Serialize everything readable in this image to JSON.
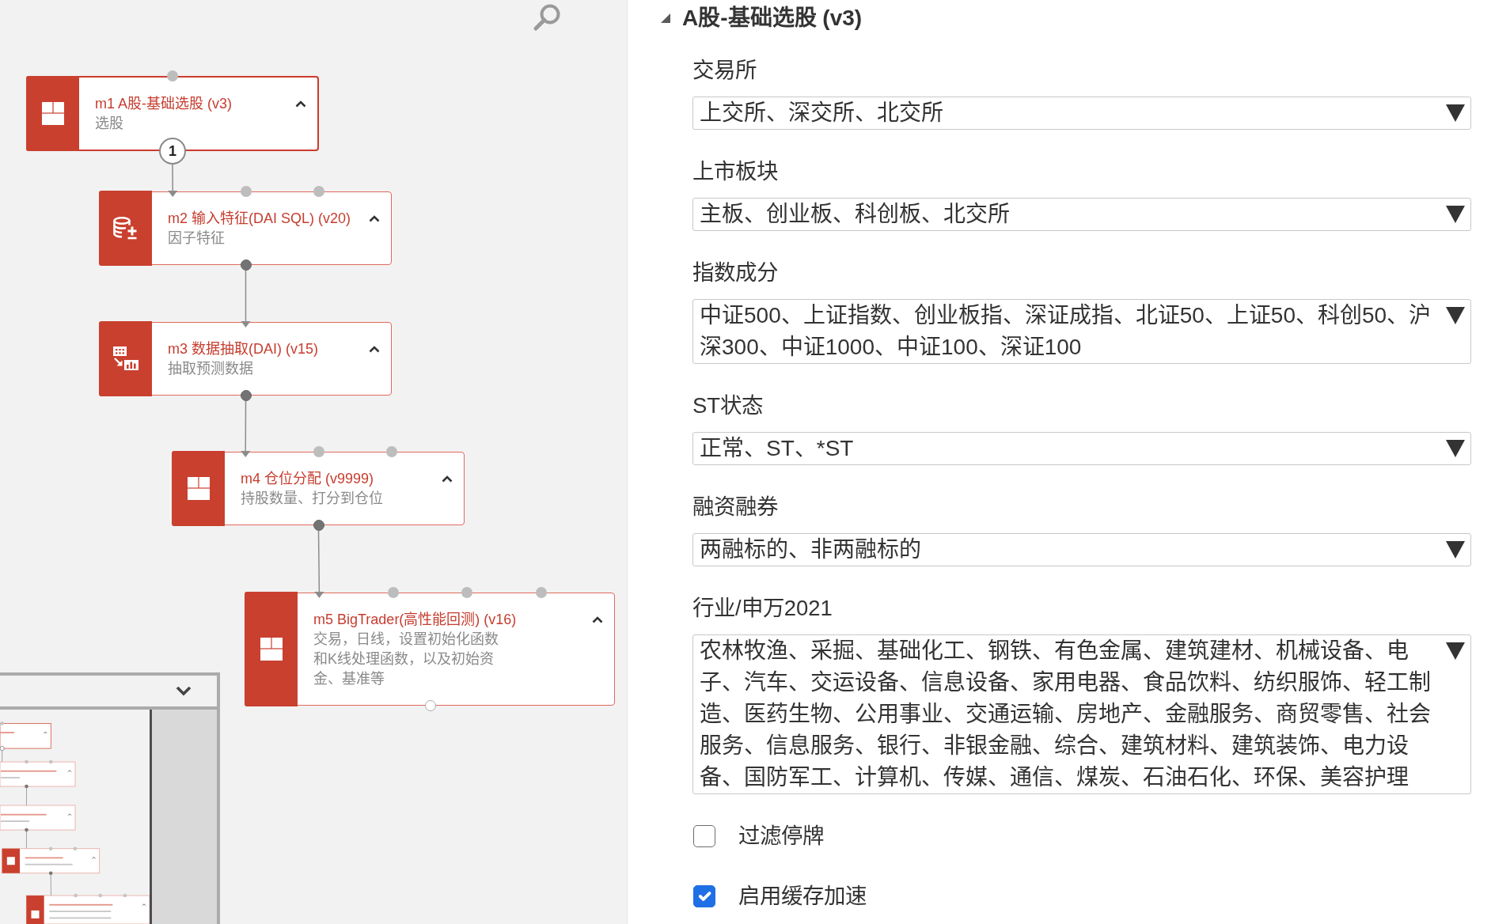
{
  "canvas": {
    "nodes": [
      {
        "kind": "module",
        "title": "m1 A股-基础选股 (v3)",
        "subtitle": "选股",
        "selected": true,
        "inputs": [
          {
            "connected": false
          }
        ],
        "output": {
          "badge": "1"
        }
      },
      {
        "kind": "sql",
        "title": "m2 输入特征(DAI SQL) (v20)",
        "subtitle": "因子特征",
        "selected": false,
        "inputs": [
          {
            "connected": true
          },
          {
            "connected": false
          },
          {
            "connected": false
          }
        ],
        "output": {
          "connected": true
        }
      },
      {
        "kind": "extract",
        "title": "m3 数据抽取(DAI) (v15)",
        "subtitle": "抽取预测数据",
        "selected": false,
        "inputs": [
          {
            "connected": true
          }
        ],
        "output": {
          "connected": true
        }
      },
      {
        "kind": "module",
        "title": "m4 仓位分配 (v9999)",
        "subtitle": "持股数量、打分到仓位",
        "selected": false,
        "inputs": [
          {
            "connected": true
          },
          {
            "connected": false
          },
          {
            "connected": false
          }
        ],
        "output": {
          "connected": true
        }
      },
      {
        "kind": "module",
        "title": "m5 BigTrader(高性能回测) (v16)",
        "subtitle": "交易，日线，设置初始化函数和K线处理函数，以及初始资金、基准等",
        "selected": false,
        "inputs": [
          {
            "connected": true
          },
          {
            "connected": false
          },
          {
            "connected": false
          },
          {
            "connected": false
          }
        ],
        "output": {
          "connected": false
        }
      }
    ]
  },
  "properties": {
    "title": "A股-基础选股 (v3)",
    "expanded": true,
    "fields": [
      {
        "kind": "dropdown",
        "label": "交易所",
        "value": "上交所、深交所、北交所"
      },
      {
        "kind": "dropdown",
        "label": "上市板块",
        "value": "主板、创业板、科创板、北交所"
      },
      {
        "kind": "dropdown",
        "label": "指数成分",
        "value": "中证500、上证指数、创业板指、深证成指、北证50、上证50、科创50、沪深300、中证1000、中证100、深证100"
      },
      {
        "kind": "dropdown",
        "label": "ST状态",
        "value": "正常、ST、*ST"
      },
      {
        "kind": "dropdown",
        "label": "融资融券",
        "value": "两融标的、非两融标的"
      },
      {
        "kind": "dropdown",
        "label": "行业/申万2021",
        "value": "农林牧渔、采掘、基础化工、钢铁、有色金属、建筑建材、机械设备、电子、汽车、交运设备、信息设备、家用电器、食品饮料、纺织服饰、轻工制造、医药生物、公用事业、交通运输、房地产、金融服务、商贸零售、社会服务、信息服务、银行、非银金融、综合、建筑材料、建筑装饰、电力设备、国防军工、计算机、传媒、通信、煤炭、石油石化、环保、美容护理"
      },
      {
        "kind": "checkbox",
        "label": "过滤停牌",
        "checked": false
      },
      {
        "kind": "checkbox",
        "label": "启用缓存加速",
        "checked": true
      }
    ]
  }
}
